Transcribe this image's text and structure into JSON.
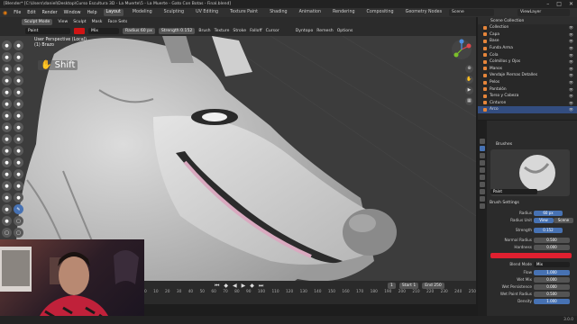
{
  "window": {
    "title": "[Blender* [C:\\Users\\daniel\\Desktop\\Curso Escultura 3D - La Muerte\\5 - La Muerte - Gato Con Botas - Final.blend]"
  },
  "menu": {
    "items": [
      "File",
      "Edit",
      "Render",
      "Window",
      "Help"
    ],
    "workspaces": [
      "Layout",
      "Modeling",
      "Sculpting",
      "UV Editing",
      "Texture Paint",
      "Shading",
      "Animation",
      "Rendering",
      "Compositing",
      "Geometry Nodes",
      "Scripting"
    ],
    "active_workspace": "Layout",
    "scene": "Scene",
    "view_layer": "ViewLayer"
  },
  "editor_header": {
    "mode": "Sculpt Mode",
    "items": [
      "View",
      "Sculpt",
      "Mask",
      "Face Sets"
    ]
  },
  "tool_header": {
    "brush": "Paint",
    "blend": "Mix",
    "radius_label": "Radius",
    "radius": "60 px",
    "strength_label": "Strength",
    "strength": "0.152",
    "menus": [
      "Brush",
      "Texture",
      "Stroke",
      "Falloff",
      "Cursor"
    ],
    "dyntopo": "Dyntopo",
    "remesh": "Remesh",
    "options": "Options"
  },
  "viewport": {
    "view": "User Perspective (Local)",
    "object": "(1) Brazo",
    "key_hint": "Shift"
  },
  "timeline": {
    "ticks": [
      "0",
      "10",
      "20",
      "30",
      "40",
      "50",
      "60",
      "70",
      "80",
      "90",
      "100",
      "110",
      "120",
      "130",
      "140",
      "150",
      "160",
      "170",
      "180",
      "190",
      "200",
      "210",
      "220",
      "230",
      "240",
      "250"
    ],
    "frame": "1",
    "start_label": "Start",
    "start": "1",
    "end_label": "End",
    "end": "250"
  },
  "outliner": {
    "title": "Scene Collection",
    "items": [
      {
        "label": "Collection"
      },
      {
        "label": "Capa"
      },
      {
        "label": "Base"
      },
      {
        "label": "Funda Arma"
      },
      {
        "label": "Cola"
      },
      {
        "label": "Colmillos y Ojos"
      },
      {
        "label": "Manos"
      },
      {
        "label": "Vendaje Piernas Detalles"
      },
      {
        "label": "Pelos"
      },
      {
        "label": "Pantalón"
      },
      {
        "label": "Torso y Cabeza"
      },
      {
        "label": "Cinturon"
      },
      {
        "label": "Arco"
      }
    ]
  },
  "properties": {
    "brushes_title": "Brushes",
    "brush_name": "Paint",
    "brush_settings_title": "Brush Settings",
    "radius_label": "Radius",
    "radius": "60 px",
    "radius_unit_label": "Radius Unit",
    "radius_unit_view": "View",
    "radius_unit_scene": "Scene",
    "strength_label": "Strength",
    "strength": "0.152",
    "normal_radius_label": "Normal Radius",
    "normal_radius": "0.500",
    "hardness_label": "Hardness",
    "hardness": "0.000",
    "blend_mode_label": "Blend Mode",
    "blend_mode": "Mix",
    "flow_label": "Flow",
    "flow": "1.000",
    "wet_mix_label": "Wet Mix",
    "wet_mix": "0.000",
    "wet_persistence_label": "Wet Persistence",
    "wet_persistence": "0.000",
    "wet_paint_radius_label": "Wet Paint Radius",
    "wet_paint_radius": "0.500",
    "density_label": "Density",
    "density": "1.000"
  },
  "status": {
    "version": "3.0.0"
  },
  "colors": {
    "accent": "#4772b3",
    "paint": "#d01414",
    "viewport": "#3c3c3c"
  }
}
